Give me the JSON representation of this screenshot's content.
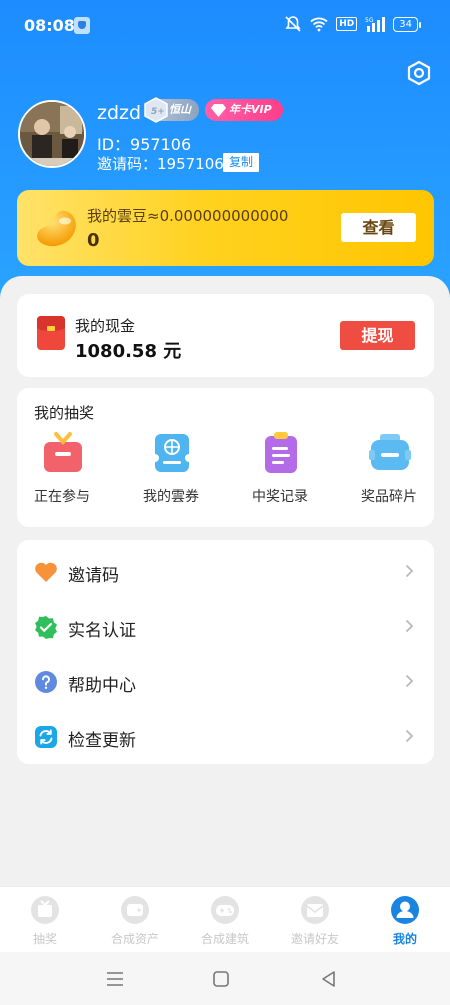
{
  "status_bar": {
    "time": "08:08",
    "network_badge": "HD",
    "signal_label": "5G",
    "battery": "34"
  },
  "profile": {
    "username": "zdzd",
    "badge_level": "恒山",
    "badge_vip": "年卡VIP",
    "id_text": "ID：957106",
    "invite_text": "邀请码：1957106",
    "copy_label": "复制"
  },
  "beans": {
    "label": "我的雲豆≈0.000000000000",
    "value": "0",
    "button": "查看"
  },
  "cash": {
    "title": "我的现金",
    "amount": "1080.58 元",
    "button": "提现"
  },
  "lottery": {
    "title": "我的抽奖",
    "items": [
      {
        "label": "正在参与",
        "icon": "gift-box-icon"
      },
      {
        "label": "我的雲券",
        "icon": "coupon-icon"
      },
      {
        "label": "中奖记录",
        "icon": "clipboard-icon"
      },
      {
        "label": "奖品碎片",
        "icon": "prize-fragment-icon"
      }
    ]
  },
  "menu": [
    {
      "label": "邀请码",
      "icon": "heart-icon"
    },
    {
      "label": "实名认证",
      "icon": "verified-badge-icon"
    },
    {
      "label": "帮助中心",
      "icon": "help-icon"
    },
    {
      "label": "检查更新",
      "icon": "refresh-icon"
    }
  ],
  "tabs": [
    {
      "label": "抽奖",
      "active": false
    },
    {
      "label": "合成资产",
      "active": false
    },
    {
      "label": "合成建筑",
      "active": false
    },
    {
      "label": "邀请好友",
      "active": false
    },
    {
      "label": "我的",
      "active": true
    }
  ],
  "colors": {
    "primary_blue": "#1d8cff",
    "bean_yellow": "#ffd21f",
    "withdraw_red": "#ef4c42",
    "active_tab": "#1b84e0"
  }
}
